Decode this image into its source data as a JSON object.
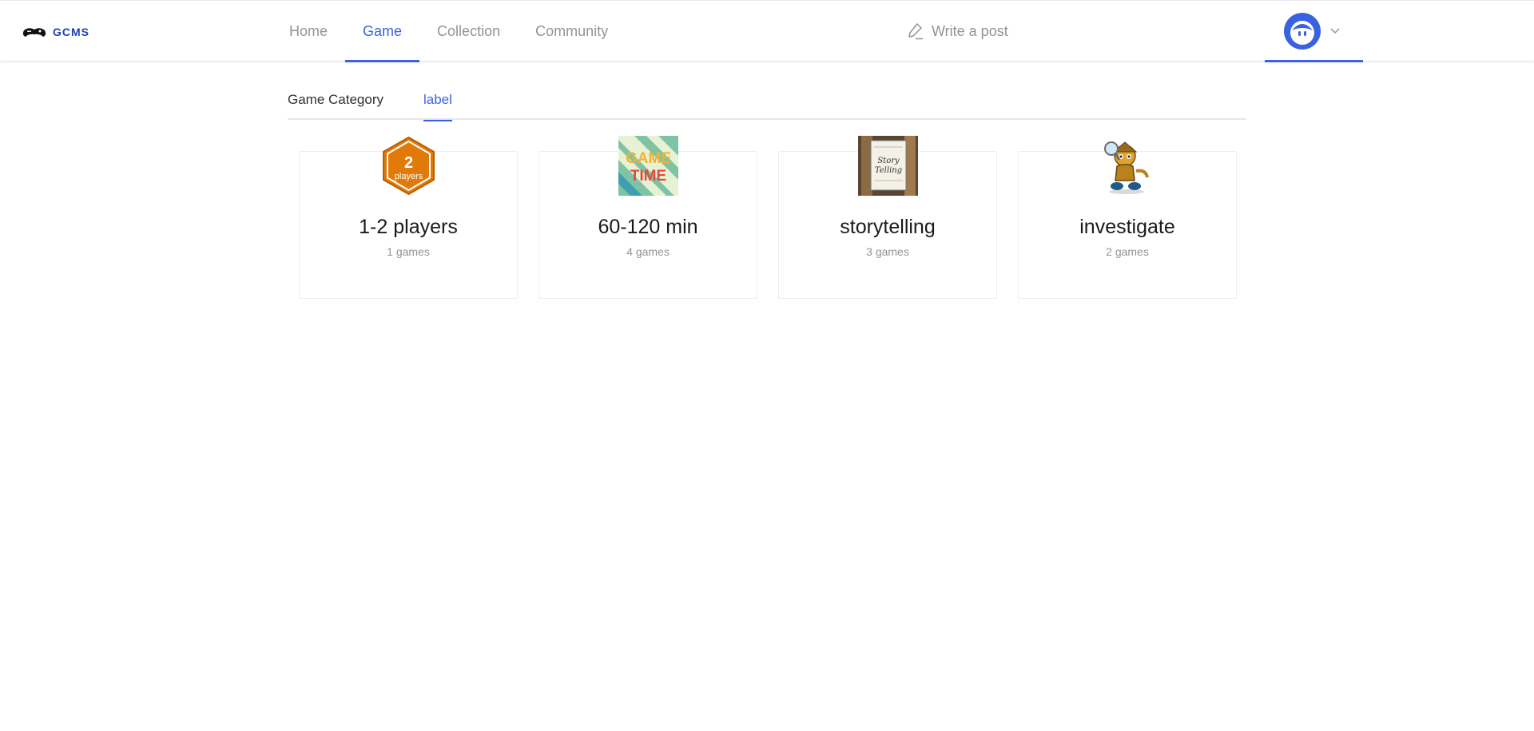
{
  "header": {
    "logo_text": "GCMS",
    "nav": [
      {
        "label": "Home"
      },
      {
        "label": "Game"
      },
      {
        "label": "Collection"
      },
      {
        "label": "Community"
      }
    ],
    "active_nav": "Game",
    "write_post_label": "Write a post",
    "icons": {
      "write": "pencil-icon",
      "dropdown": "chevron-down-icon",
      "avatar": "user-avatar-icon"
    }
  },
  "tabs": [
    {
      "label": "Game Category"
    },
    {
      "label": "label"
    }
  ],
  "active_tab": "label",
  "labels": [
    {
      "title": "1-2 players",
      "count": "1 games",
      "icon": "two-players-hexagon-icon",
      "icon_text": "2",
      "icon_subtext": "players"
    },
    {
      "title": "60-120 min",
      "count": "4 games",
      "icon": "game-time-icon",
      "icon_text": "GAME",
      "icon_subtext": "TIME"
    },
    {
      "title": "storytelling",
      "count": "3 games",
      "icon": "story-book-icon",
      "icon_text": "Story Telling"
    },
    {
      "title": "investigate",
      "count": "2 games",
      "icon": "detective-icon"
    }
  ],
  "colors": {
    "accent": "#3a62e0",
    "muted": "#909399",
    "text": "#303133",
    "badge_orange": "#e07b0a"
  }
}
